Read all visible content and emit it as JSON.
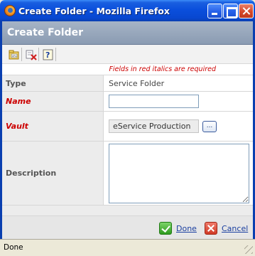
{
  "window": {
    "title": "Create Folder - Mozilla Firefox"
  },
  "header": {
    "title": "Create Folder"
  },
  "toolbar": {
    "icons": [
      "new-folder-icon",
      "clear-fields-icon",
      "help-icon"
    ]
  },
  "form": {
    "required_note": "Fields in red italics are required",
    "type": {
      "label": "Type",
      "value": "Service Folder"
    },
    "name": {
      "label": "Name",
      "value": ""
    },
    "vault": {
      "label": "Vault",
      "value": "eService Production",
      "browse_label": "..."
    },
    "description": {
      "label": "Description",
      "value": ""
    }
  },
  "footer": {
    "done_label": "Done",
    "cancel_label": "Cancel"
  },
  "status": {
    "text": "Done"
  },
  "colors": {
    "required": "#cc0000",
    "header_bg": "#97a6bc",
    "titlebar": "#0a4fdc"
  }
}
